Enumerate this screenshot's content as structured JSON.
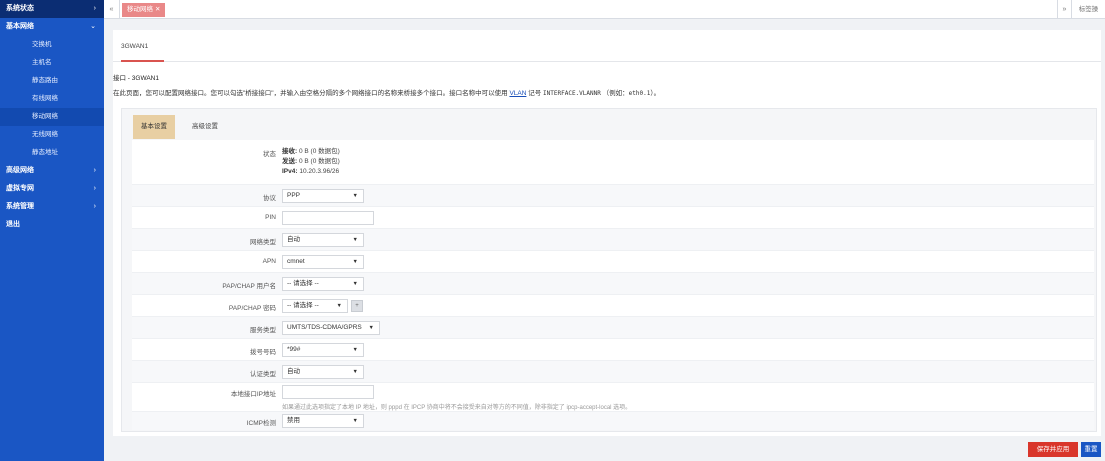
{
  "sidebar": {
    "items": [
      {
        "label": "系统状态",
        "arrow": "›"
      },
      {
        "label": "基本网络",
        "arrow": "⌄"
      },
      {
        "label": "高级网络",
        "arrow": "›"
      },
      {
        "label": "虚拟专网",
        "arrow": "›"
      },
      {
        "label": "系统管理",
        "arrow": "›"
      },
      {
        "label": "退出",
        "arrow": ""
      }
    ],
    "subitems": [
      "交换机",
      "主机名",
      "静态路由",
      "有线网络",
      "移动网络",
      "无线网络",
      "静态地址"
    ]
  },
  "tabbar": {
    "left_btn": "«",
    "active_tab": "移动网络",
    "tab_close": "✕",
    "right_btn": "»",
    "close_label": "标签操"
  },
  "main": {
    "section_tab": "3GWAN1",
    "title": "接口 - 3GWAN1",
    "desc_part1": "在此页面，您可以配置网络接口。您可以勾选\"桥接接口\"，并输入由空格分隔的多个网络接口的名称来桥接多个接口。接口名称中可以使用",
    "desc_link": "VLAN",
    "desc_part2": "记号",
    "desc_mono": "INTERFACE.VLANNR",
    "desc_part3": "（例如：",
    "desc_mono2": "eth0.1",
    "desc_part4": "）。",
    "tabs": {
      "basic": "基本设置",
      "advanced": "高级设置"
    }
  },
  "form": {
    "status_label": "状态",
    "status_rx_key": "接收:",
    "status_rx_val": "0 B (0 数据包)",
    "status_tx_key": "发送:",
    "status_tx_val": "0 B (0 数据包)",
    "status_ip_key": "IPv4:",
    "status_ip_val": "10.20.3.96/26",
    "protocol_label": "协议",
    "protocol_value": "PPP",
    "pin_label": "PIN",
    "pin_value": "",
    "nettype_label": "网络类型",
    "nettype_value": "自动",
    "apn_label": "APN",
    "apn_value": "cmnet",
    "papuser_label": "PAP/CHAP 用户名",
    "papuser_value": "-- 请选择 --",
    "pappass_label": "PAP/CHAP 密码",
    "pappass_value": "-- 请选择 --",
    "pappass_plus": "+",
    "service_label": "服务类型",
    "service_value": "UMTS/TDS-CDMA/GPRS",
    "dial_label": "拨号号码",
    "dial_value": "*99#",
    "auth_label": "认证类型",
    "auth_value": "自动",
    "localip_label": "本地接口IP地址",
    "localip_value": "",
    "localip_hint": "如果通过此选项指定了本地 IP 地址，则 pppd 在 IPCP 协商中将不会接受来自对等方的不同值，除非指定了 ipcp-accept-local 选项。",
    "icmp_label": "ICMP检测",
    "icmp_value": "禁用",
    "caret": "▼"
  },
  "buttons": {
    "save_apply": "保存并应用",
    "reset": "重置"
  }
}
